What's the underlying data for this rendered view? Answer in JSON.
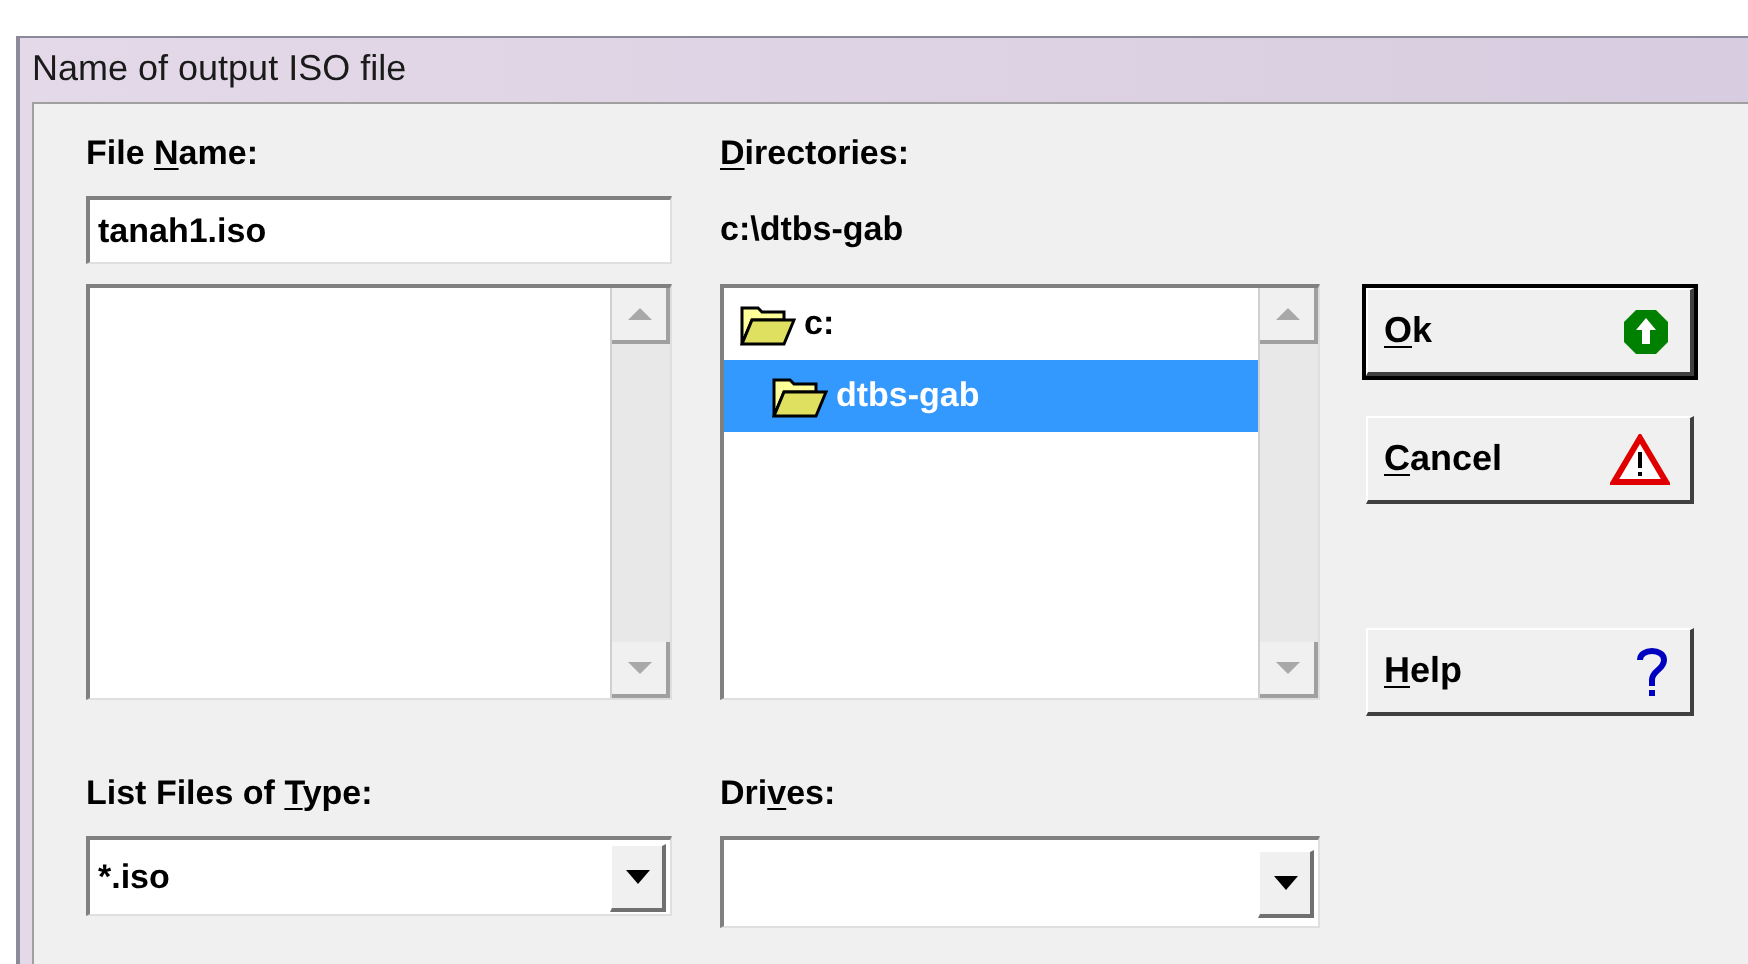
{
  "window": {
    "title": "Name of output ISO file"
  },
  "file_name": {
    "label": [
      {
        "text": "File ",
        "underlined": false
      },
      {
        "text": "N",
        "underlined": true
      },
      {
        "text": "ame:",
        "underlined": false
      }
    ],
    "value": "tanah1.iso"
  },
  "directories": {
    "label": [
      {
        "text": "D",
        "underlined": true
      },
      {
        "text": "irectories:",
        "underlined": false
      }
    ],
    "path": "c:\\dtbs-gab",
    "tree": [
      {
        "name": "c:",
        "selected": false,
        "children": [
          {
            "name": "dtbs-gab",
            "selected": true
          }
        ]
      }
    ]
  },
  "list_files_of_type": {
    "label": [
      {
        "text": "List Files of ",
        "underlined": false
      },
      {
        "text": "T",
        "underlined": true
      },
      {
        "text": "ype:",
        "underlined": false
      }
    ],
    "value": "*.iso"
  },
  "drives": {
    "label": [
      {
        "text": "Dri",
        "underlined": false
      },
      {
        "text": "v",
        "underlined": true
      },
      {
        "text": "es:",
        "underlined": false
      }
    ]
  },
  "buttons": [
    {
      "label": [
        {
          "text": "O",
          "underlined": true
        },
        {
          "text": "k",
          "underlined": false
        }
      ],
      "kind": "ok",
      "default": true
    },
    {
      "label": [
        {
          "text": "C",
          "underlined": true
        },
        {
          "text": "ancel",
          "underlined": false
        }
      ],
      "kind": "cancel",
      "default": false
    },
    {
      "label": [
        {
          "text": "H",
          "underlined": true
        },
        {
          "text": "elp",
          "underlined": false
        }
      ],
      "kind": "help",
      "default": false
    }
  ]
}
